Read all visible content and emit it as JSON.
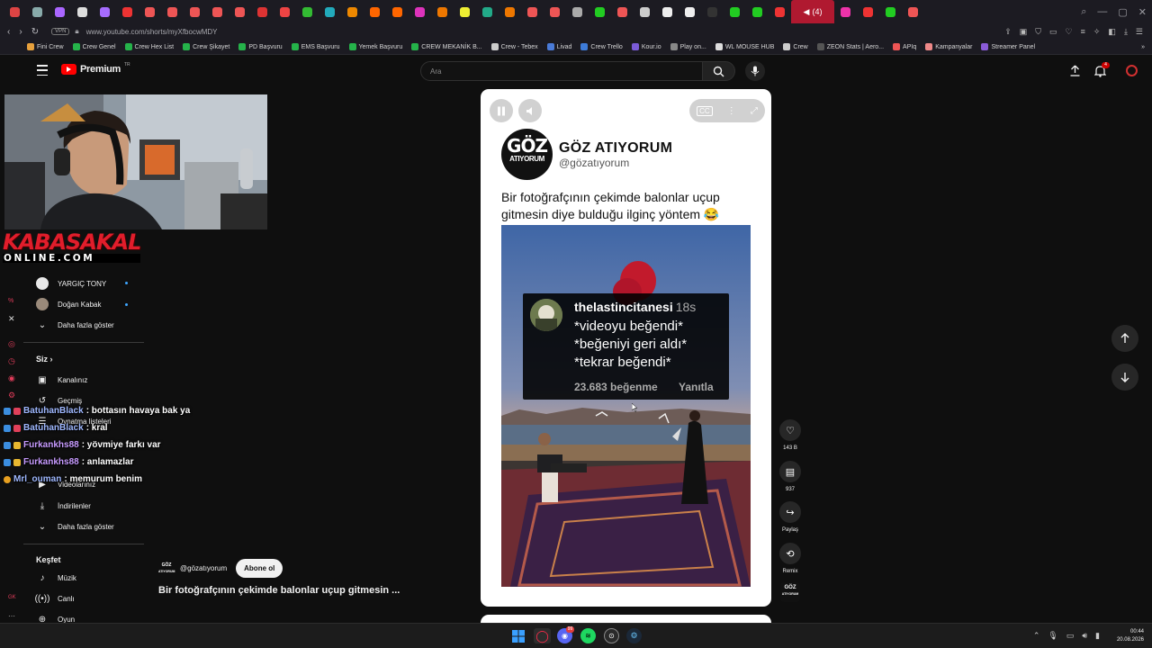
{
  "browser": {
    "active_tab_label": "(4)",
    "url": "www.youtube.com/shorts/myXfbocwMDY",
    "vpn_label": "VPN",
    "tab_colors": [
      "#d44",
      "#8aa",
      "#a6f",
      "#ddd",
      "#a66cff",
      "#e33",
      "#e55",
      "#e55",
      "#e55",
      "#e55",
      "#e55",
      "#d33",
      "#e44",
      "#3b3",
      "#2ab",
      "#e80",
      "#f60",
      "#f60",
      "#d3b",
      "#e70",
      "#ee3",
      "#2a8",
      "#e70",
      "#e55",
      "#e55",
      "#aaa",
      "#2c2",
      "#e55",
      "#ccc",
      "#eee",
      "#eee",
      "#333",
      "#2c2",
      "#2c2",
      "#e33",
      "#e3a",
      "#e33",
      "#2c2",
      "#e55"
    ],
    "bookmarks": [
      {
        "label": "Fini Crew",
        "color": "#e8a13c"
      },
      {
        "label": "Crew Genel",
        "color": "#25b34a"
      },
      {
        "label": "Crew Hex List",
        "color": "#25b34a"
      },
      {
        "label": "Crew Şikayet",
        "color": "#25b34a"
      },
      {
        "label": "PD Başvuru",
        "color": "#25b34a"
      },
      {
        "label": "EMS Başvuru",
        "color": "#25b34a"
      },
      {
        "label": "Yemek Başvuru",
        "color": "#25b34a"
      },
      {
        "label": "CREW MEKANİK B...",
        "color": "#25b34a"
      },
      {
        "label": "Crew - Tebex",
        "color": "#ccc"
      },
      {
        "label": "Livad",
        "color": "#4a7bd8"
      },
      {
        "label": "Crew Trello",
        "color": "#3d7bd8"
      },
      {
        "label": "Kour.io",
        "color": "#7b5bd8"
      },
      {
        "label": "Play on...",
        "color": "#888"
      },
      {
        "label": "WL MOUSE HUB",
        "color": "#ddd"
      },
      {
        "label": "Crew",
        "color": "#ccc"
      },
      {
        "label": "ZEON Stats | Aero...",
        "color": "#555"
      },
      {
        "label": "APIq",
        "color": "#e55"
      },
      {
        "label": "Kampanyalar",
        "color": "#e88"
      },
      {
        "label": "Streamer Panel",
        "color": "#8a5bd8"
      }
    ]
  },
  "header": {
    "logo_text": "Premium",
    "logo_sup": "TR",
    "search_placeholder": "Ara",
    "notification_count": "4",
    "brand_color": "#ff0000"
  },
  "stream_overlay": {
    "brand_line1": "KABASAKAL",
    "brand_line2": "ONLINE.COM"
  },
  "sidebar": {
    "subscriptions": [
      {
        "label": "YARGIÇ TONY"
      },
      {
        "label": "Doğan Kabak"
      }
    ],
    "show_more": "Daha fazla göster",
    "you_header": "Siz",
    "you_items": [
      {
        "label": "Kanalınız",
        "icon": "channel-icon"
      },
      {
        "label": "Geçmiş",
        "icon": "history-icon"
      },
      {
        "label": "Oynatma listeleri",
        "icon": "playlists-icon"
      },
      {
        "label": "Videolarınız",
        "icon": "your-videos-icon"
      },
      {
        "label": "İndirilenler",
        "icon": "downloads-icon"
      }
    ],
    "show_more_2": "Daha fazla göster",
    "explore_header": "Keşfet",
    "explore_items": [
      {
        "label": "Müzik",
        "icon": "music-icon"
      },
      {
        "label": "Canlı",
        "icon": "live-icon"
      },
      {
        "label": "Oyun",
        "icon": "gaming-icon"
      }
    ]
  },
  "chat": [
    {
      "user": "BatuhanBlack",
      "message": ": bottasın havaya bak ya"
    },
    {
      "user": "BatuhanBlack",
      "message": ": kral"
    },
    {
      "user": "Furkankhs88",
      "message": ": yövmiye farkı var"
    },
    {
      "user": "Furkankhs88",
      "message": ": anlamazlar"
    },
    {
      "user": "Mrl_ouman",
      "message": ": memurum benim"
    }
  ],
  "short": {
    "channel_handle": "@gözatıyorum",
    "subscribe_label": "Abone ol",
    "title": "Bir fotoğrafçının çekimde balonlar uçup gitmesin ...",
    "card": {
      "logo_line1": "GÖZ",
      "logo_line2": "ATIYORUM",
      "account_name": "GÖZ ATIYORUM",
      "account_handle": "@gözatıyorum",
      "post_text": "Bir fotoğrafçının çekimde balonlar uçup gitmesin diye bulduğu ilginç yöntem 😂",
      "comment": {
        "user": "thelastincitanesi",
        "time": "18s",
        "lines": [
          "*videoyu beğendi*",
          "*beğeniyi geri aldı*",
          "*tekrar beğendi*"
        ],
        "likes": "23.683 beğenme",
        "reply": "Yanıtla"
      }
    },
    "actions": {
      "like_count": "143 B",
      "comment_count": "937",
      "share_label": "Paylaş",
      "remix_label": "Remix"
    }
  },
  "taskbar": {
    "time": "00:44",
    "date": "20.08.2026",
    "discord_badge": "99"
  }
}
